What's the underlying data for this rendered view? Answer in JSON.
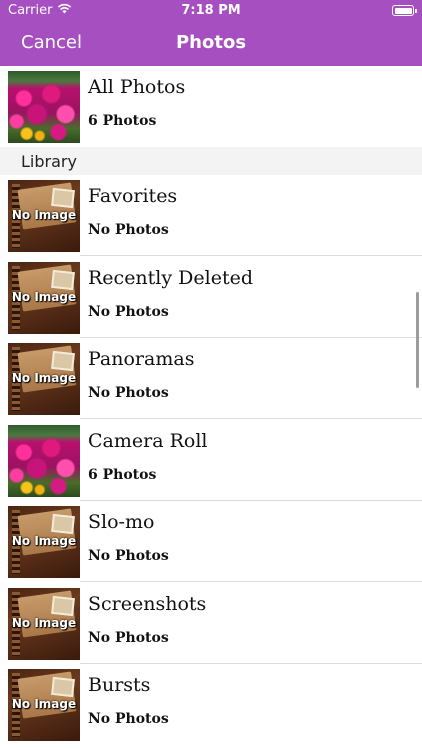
{
  "status_bar": {
    "carrier": "Carrier",
    "time": "7:18 PM"
  },
  "nav": {
    "cancel_label": "Cancel",
    "title": "Photos"
  },
  "all_photos": {
    "title": "All Photos",
    "count": "6 Photos",
    "thumbnail": "flowers"
  },
  "section": {
    "title": "Library"
  },
  "no_image_label": "No Image",
  "albums": [
    {
      "title": "Favorites",
      "count": "No Photos",
      "thumbnail": "no-image"
    },
    {
      "title": "Recently Deleted",
      "count": "No Photos",
      "thumbnail": "no-image"
    },
    {
      "title": "Panoramas",
      "count": "No Photos",
      "thumbnail": "no-image"
    },
    {
      "title": "Camera Roll",
      "count": "6 Photos",
      "thumbnail": "flowers"
    },
    {
      "title": "Slo-mo",
      "count": "No Photos",
      "thumbnail": "no-image"
    },
    {
      "title": "Screenshots",
      "count": "No Photos",
      "thumbnail": "no-image"
    },
    {
      "title": "Bursts",
      "count": "No Photos",
      "thumbnail": "no-image"
    }
  ],
  "colors": {
    "nav_background": "#a54fc0",
    "separator": "#dcdcdc",
    "section_background": "#f3f3f3"
  }
}
